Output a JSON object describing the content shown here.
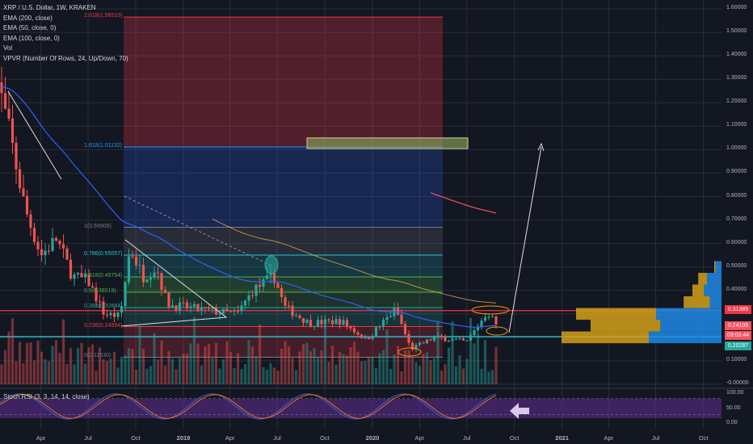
{
  "legend": {
    "title": "XRP / U.S. Dollar, 1W, KRAKEN",
    "indicators": [
      "EMA (200, close)",
      "EMA (50, close, 0)",
      "EMA (100, close, 0)",
      "Vol",
      "VPVR (Number Of Rows, 24, Up/Down, 70)"
    ]
  },
  "rsi_title": "Stoch RSI (3, 3, 14, 14, close)",
  "colors": {
    "up": "#26a69a",
    "down": "#ef5350",
    "background": "#131722",
    "resistance": "#f23645",
    "support": "#26c6da",
    "ema200": "#f7525f",
    "ema50": "#2962ff",
    "vp_up": "#1e88e5",
    "vp_down": "#d4a017",
    "rsi_k": "#2962ff",
    "rsi_d": "#ff6d00",
    "rsi_band": "#5b2c8a"
  },
  "price_badges": [
    {
      "text": "0.31389",
      "color": "#f23645"
    },
    {
      "text": "0.24105",
      "color": "#f7525f"
    },
    {
      "text": "03:03:44",
      "color": "#f7525f"
    },
    {
      "text": "0.20287",
      "color": "#26a69a"
    }
  ],
  "chart_data": [
    {
      "type": "candlestick",
      "title": "XRP / U.S. Dollar, 1W, KRAKEN",
      "x_ticks": [
        "Apr",
        "Jul",
        "Oct",
        "2019",
        "Apr",
        "Jul",
        "Oct",
        "2020",
        "Apr",
        "Jul",
        "Oct",
        "2021",
        "Apr",
        "Jul",
        "Oct"
      ],
      "y_ticks": [
        "1.60000",
        "1.50000",
        "1.40000",
        "1.30000",
        "1.20000",
        "1.10000",
        "1.00000",
        "0.90000",
        "0.80000",
        "0.70000",
        "0.60000",
        "0.50000",
        "0.40000",
        "0.30000",
        "0.20000",
        "0.10000",
        "-0.00000"
      ],
      "ylim": [
        -0.005,
        1.62
      ],
      "price_path": [
        [
          "2018-01-01",
          1.35
        ],
        [
          "2018-02-01",
          1.05
        ],
        [
          "2018-03-01",
          0.75
        ],
        [
          "2018-04-01",
          0.55
        ],
        [
          "2018-05-01",
          0.62
        ],
        [
          "2018-06-01",
          0.46
        ],
        [
          "2018-07-01",
          0.44
        ],
        [
          "2018-08-01",
          0.3
        ],
        [
          "2018-09-01",
          0.29
        ],
        [
          "2018-09-20",
          0.58
        ],
        [
          "2018-10-15",
          0.46
        ],
        [
          "2018-11-10",
          0.5
        ],
        [
          "2018-12-01",
          0.34
        ],
        [
          "2019-01-01",
          0.33
        ],
        [
          "2019-03-01",
          0.31
        ],
        [
          "2019-04-15",
          0.3
        ],
        [
          "2019-05-15",
          0.4
        ],
        [
          "2019-06-25",
          0.46
        ],
        [
          "2019-07-15",
          0.33
        ],
        [
          "2019-09-01",
          0.26
        ],
        [
          "2019-11-01",
          0.27
        ],
        [
          "2019-12-20",
          0.19
        ],
        [
          "2020-02-15",
          0.32
        ],
        [
          "2020-03-15",
          0.15
        ],
        [
          "2020-05-01",
          0.2
        ],
        [
          "2020-07-01",
          0.18
        ],
        [
          "2020-08-10",
          0.31
        ],
        [
          "2020-09-01",
          0.24
        ]
      ],
      "fib_levels": [
        {
          "label": "2.618(1.56510)",
          "value": 1.5651
        },
        {
          "label": "1.618(1.01132)",
          "value": 1.01132
        },
        {
          "label": "1(0.66908)",
          "value": 0.66908
        },
        {
          "label": "0.786(0.55057)",
          "value": 0.55057
        },
        {
          "label": "0.618(0.45754)",
          "value": 0.45754
        },
        {
          "label": "0.5(0.39219)",
          "value": 0.39219
        },
        {
          "label": "0.382(0.32684)",
          "value": 0.32684
        },
        {
          "label": "0.236(0.24594)",
          "value": 0.24594
        },
        {
          "label": "0(0.11530)",
          "value": 0.1153
        }
      ],
      "horizontal_lines": {
        "resistance": 0.31389,
        "support": 0.20287
      },
      "target_zone": [
        1.01132,
        1.05
      ],
      "volume_profile": [
        {
          "price": 0.5,
          "up": 0.04,
          "down": 0.01
        },
        {
          "price": 0.45,
          "up": 0.1,
          "down": 0.06
        },
        {
          "price": 0.4,
          "up": 0.12,
          "down": 0.08
        },
        {
          "price": 0.35,
          "up": 0.08,
          "down": 0.18
        },
        {
          "price": 0.3,
          "up": 0.45,
          "down": 0.55
        },
        {
          "price": 0.25,
          "up": 0.42,
          "down": 0.48
        },
        {
          "price": 0.2,
          "up": 0.5,
          "down": 0.6
        }
      ]
    },
    {
      "type": "line",
      "title": "Stoch RSI (3, 3, 14, 14, close)",
      "y_ticks": [
        "100.00",
        "50.00",
        "0.00"
      ],
      "ylim": [
        0,
        100
      ]
    }
  ]
}
